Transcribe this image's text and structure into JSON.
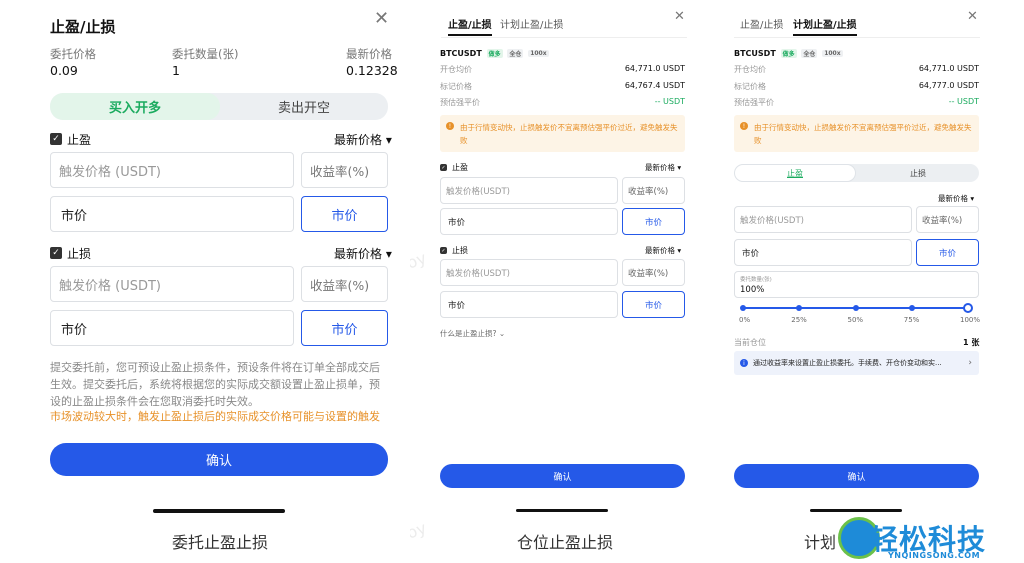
{
  "panels": {
    "p1": {
      "title": "止盈/止损",
      "close": "✕",
      "info": {
        "order_price_label": "委托价格",
        "order_price": "0.09",
        "order_qty_label": "委托数量(张)",
        "order_qty": "1",
        "latest_price_label": "最新价格",
        "latest_price": "0.12328"
      },
      "segment": {
        "active": "买入开多",
        "inactive": "卖出开空"
      },
      "tp": {
        "label": "止盈",
        "select": "最新价格 ▾",
        "trigger_placeholder": "触发价格 (USDT)",
        "yield": "收益率(%)",
        "price": "市价",
        "market_btn": "市价"
      },
      "sl": {
        "label": "止损",
        "select": "最新价格 ▾",
        "trigger_placeholder": "触发价格 (USDT)",
        "yield": "收益率(%)",
        "price": "市价",
        "market_btn": "市价"
      },
      "desc": "提交委托前，您可预设止盈止损条件，预设条件将在订单全部成交后生效。提交委托后，系统将根据您的实际成交额设置止盈止损单，预设的止盈止损条件会在您取消委托时失效。",
      "warning": "市场波动较大时，触发止盈止损后的实际成交价格可能与设置的触发价格有所",
      "confirm": "确认",
      "caption": "委托止盈止损"
    },
    "p2": {
      "tab_active": "止盈/止损",
      "tab_inactive": "计划止盈/止损",
      "close": "✕",
      "symbol": "BTCUSDT",
      "badges": [
        "做多",
        "全仓",
        "100x"
      ],
      "rows": [
        {
          "k": "开仓均价",
          "v": "64,771.0 USDT"
        },
        {
          "k": "标记价格",
          "v": "64,767.4 USDT"
        },
        {
          "k": "预估强平价",
          "v": "-- USDT"
        }
      ],
      "notice": "由于行情变动快，止损触发价不宜离预估强平价过近，避免触发失败",
      "tp": {
        "label": "止盈",
        "select": "最新价格 ▾",
        "trigger_placeholder": "触发价格(USDT)",
        "yield": "收益率(%)",
        "price": "市价",
        "market_btn": "市价"
      },
      "sl": {
        "label": "止损",
        "select": "最新价格 ▾",
        "trigger_placeholder": "触发价格(USDT)",
        "yield": "收益率(%)",
        "price": "市价",
        "market_btn": "市价"
      },
      "help_link": "什么是止盈止损?  ⌄",
      "confirm": "确认",
      "caption": "仓位止盈止损"
    },
    "p3": {
      "tab_inactive": "止盈/止损",
      "tab_active": "计划止盈/止损",
      "close": "✕",
      "symbol": "BTCUSDT",
      "badges": [
        "做多",
        "全仓",
        "100x"
      ],
      "rows": [
        {
          "k": "开仓均价",
          "v": "64,771.0 USDT"
        },
        {
          "k": "标记价格",
          "v": "64,777.0 USDT"
        },
        {
          "k": "预估强平价",
          "v": "-- USDT"
        }
      ],
      "notice": "由于行情变动快，止损触发价不宜离预估强平价过近，避免触发失败",
      "seg_active": "止盈",
      "seg_inactive": "止损",
      "select": "最新价格 ▾",
      "trigger_placeholder": "触发价格(USDT)",
      "yield": "收益率(%)",
      "price": "市价",
      "market_btn": "市价",
      "qty_label": "委托数量(张)",
      "qty_value": "100%",
      "slider_ticks": [
        "0%",
        "25%",
        "50%",
        "75%",
        "100%"
      ],
      "slider_value": 1.0,
      "position_label": "当前仓位",
      "position_value": "1 张",
      "info": "通过收益率来设置止盈止损委托。手续费、开仓价变动和实...",
      "confirm": "确认",
      "caption": "计划"
    }
  },
  "logo": {
    "text": "轻松科技",
    "sub": "YNQINGSONG.COM"
  },
  "watermark": "Joy--GA Jul 24, 2024, 3:41 PM RDJ",
  "colors": {
    "accent": "#2559e8",
    "green": "#1bab5f",
    "warning": "#e79129"
  }
}
